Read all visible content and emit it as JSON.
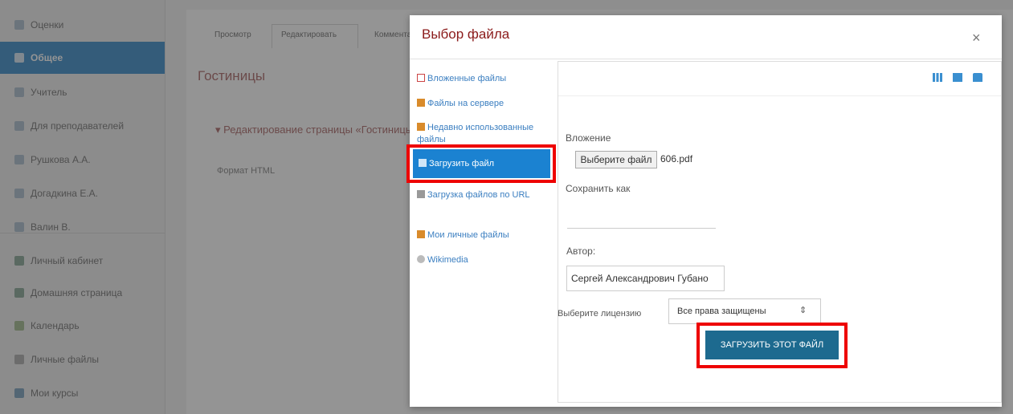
{
  "sidebar": {
    "items": [
      {
        "label": "Оценки",
        "icon": "list-icon"
      },
      {
        "label": "Общее",
        "icon": "folder-icon"
      },
      {
        "label": "Учитель",
        "icon": "folder-icon"
      },
      {
        "label": "Для преподавателей",
        "icon": "folder-icon"
      },
      {
        "label": "Рушкова А.А.",
        "icon": "folder-icon"
      },
      {
        "label": "Догадкина Е.А.",
        "icon": "folder-icon"
      },
      {
        "label": "Валин В.",
        "icon": "folder-icon"
      },
      {
        "label": "Личный кабинет",
        "icon": "dashboard-icon"
      },
      {
        "label": "Домашняя страница",
        "icon": "home-icon"
      },
      {
        "label": "Календарь",
        "icon": "calendar-icon"
      },
      {
        "label": "Личные файлы",
        "icon": "file-icon"
      },
      {
        "label": "Мои курсы",
        "icon": "graduation-cap-icon"
      }
    ]
  },
  "background": {
    "tabs": [
      "Просмотр",
      "Редактировать",
      "Комментарии"
    ],
    "page_title": "Гостиницы",
    "editing_heading": "Редактирование страницы «Гостиницы»",
    "format_label": "Формат HTML"
  },
  "dialog": {
    "title": "Выбор файла",
    "close": "×",
    "repositories": [
      {
        "label": "Вложенные файлы",
        "icon": "attachment-icon"
      },
      {
        "label": "Файлы на сервере",
        "icon": "server-icon"
      },
      {
        "label": "Недавно использованные файлы",
        "icon": "recent-icon"
      },
      {
        "label": "Загрузить файл",
        "icon": "upload-icon"
      },
      {
        "label": "Загрузка файлов по URL",
        "icon": "url-download-icon"
      },
      {
        "label": "Мои личные файлы",
        "icon": "private-files-icon"
      },
      {
        "label": "Wikimedia",
        "icon": "wikimedia-icon"
      }
    ],
    "form": {
      "attachment_label": "Вложение",
      "choose_button": "Выберите файл",
      "file_name": "606.pdf",
      "save_as_label": "Сохранить как",
      "save_as_value": "",
      "author_label": "Автор:",
      "author_value": "Сергей Александрович Губано",
      "license_label": "Выберите лицензию",
      "license_value": "Все права защищены",
      "upload_button": "ЗАГРУЗИТЬ ЭТОТ ФАЙЛ"
    }
  },
  "colors": {
    "accent": "#1b82d1",
    "title": "#8b1a1a",
    "highlight": "#ee0000",
    "upload_button": "#1d6a8f"
  }
}
